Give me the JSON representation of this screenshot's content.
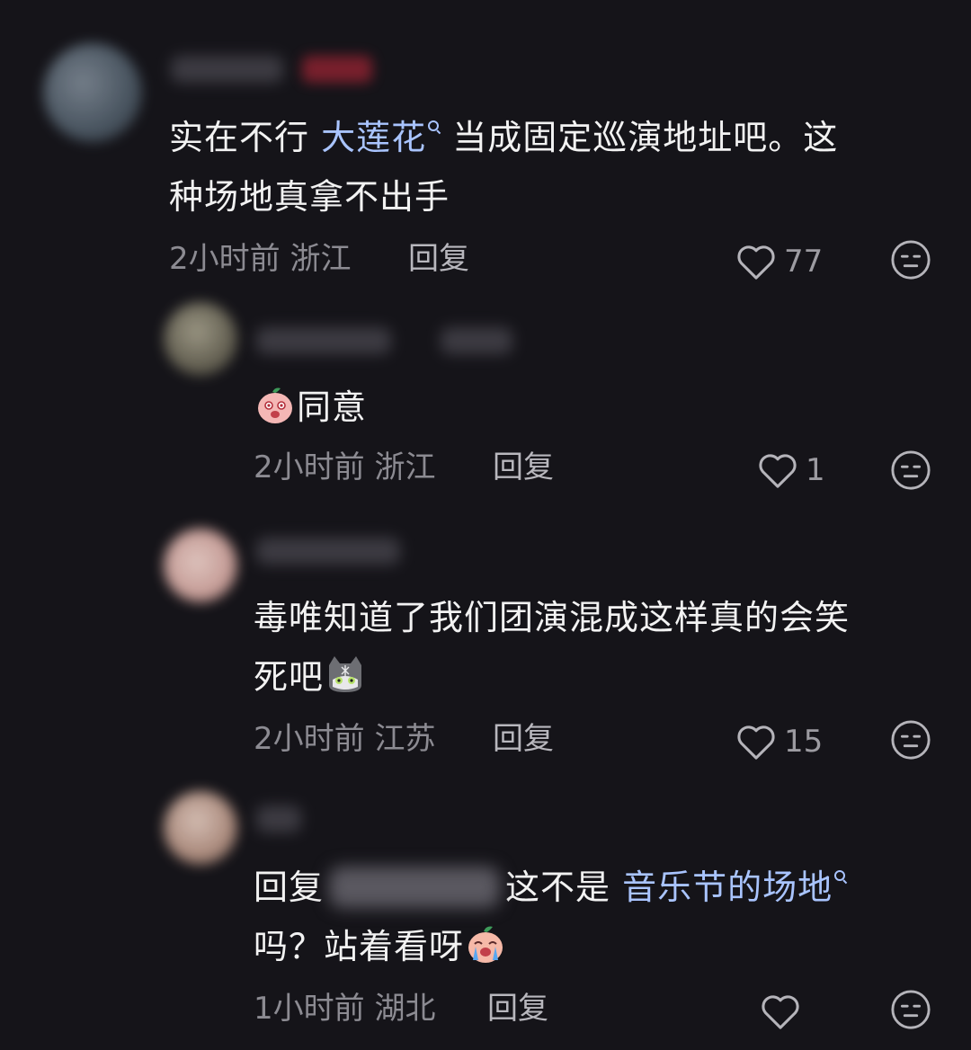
{
  "comments": [
    {
      "text_before": "实在不行 ",
      "link": "大莲花",
      "text_after": " 当成固定巡演地址吧。这",
      "line2": "种场地真拿不出手",
      "time": "2小时前",
      "location": "浙江",
      "reply_label": "回复",
      "likes": "77"
    },
    {
      "text": "同意",
      "time": "2小时前",
      "location": "浙江",
      "reply_label": "回复",
      "likes": "1"
    },
    {
      "line1": "毒唯知道了我们团演混成这样真的会笑",
      "line2": "死吧",
      "time": "2小时前",
      "location": "江苏",
      "reply_label": "回复",
      "likes": "15"
    },
    {
      "reply_prefix": "回复",
      "text_after": "这不是 ",
      "link": "音乐节的场地",
      "line2": "吗？站着看呀",
      "time": "1小时前",
      "location": "湖北",
      "reply_label": "回复"
    }
  ],
  "icons": {
    "like": "heart-outline-icon",
    "dislike": "neutral-face-icon",
    "link_marker": "search-icon"
  },
  "colors": {
    "background": "#151419",
    "text": "#f2f2f2",
    "link": "#a9c4ff",
    "meta": "#8c8b92"
  }
}
